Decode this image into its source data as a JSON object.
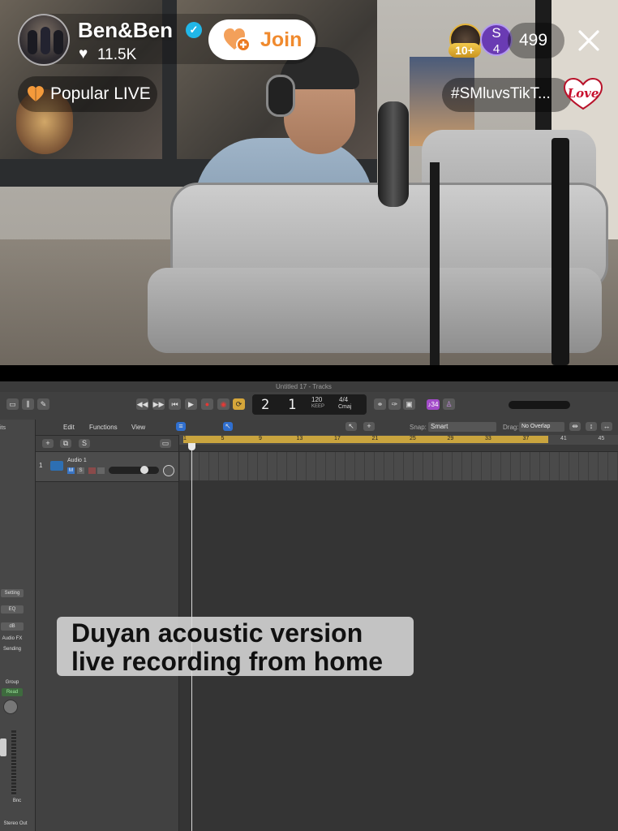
{
  "stream": {
    "host_name": "Ben&Ben",
    "like_count": "11.5K",
    "join_label": "Join",
    "popular_label": "Popular LIVE",
    "viewer_badge_1": "10+",
    "viewer_badge_2_initial": "S",
    "viewer_badge_2_rank": "4",
    "viewer_count": "499",
    "hashtag": "#SMluvsTikT...",
    "sticker_text": "Love",
    "colors": {
      "join_accent": "#f08a2e",
      "verified": "#21b7e8"
    }
  },
  "daw": {
    "window_title": "Untitled 17 - Tracks",
    "lcd": {
      "bar": "2",
      "beat": "1",
      "tempo": "120",
      "tempo_sub": "KEEP",
      "time_signature": "4/4",
      "key": "Cmaj"
    },
    "count_in": "♪34",
    "menus": {
      "edit": "Edit",
      "functions": "Functions",
      "view": "View"
    },
    "snap_label": "Snap:",
    "snap_value": "Smart",
    "drag_label": "Drag:",
    "drag_value": "No Overlap",
    "inspector": {
      "region_label": "its",
      "setting": "Setting",
      "eq": "EQ",
      "audio_fx": "Audio FX",
      "sending": "Sending",
      "group": "Group",
      "read": "Read",
      "bnc": "Bnc",
      "stereo_out": "Stereo Out"
    },
    "track": {
      "number": "1",
      "name": "Audio 1",
      "mute": "M",
      "solo": "S"
    },
    "ruler": [
      "1",
      "5",
      "9",
      "13",
      "17",
      "21",
      "25",
      "29",
      "33",
      "37",
      "41",
      "45"
    ]
  },
  "caption": {
    "line_1": "Duyan acoustic version",
    "line_2": "live recording from home"
  }
}
